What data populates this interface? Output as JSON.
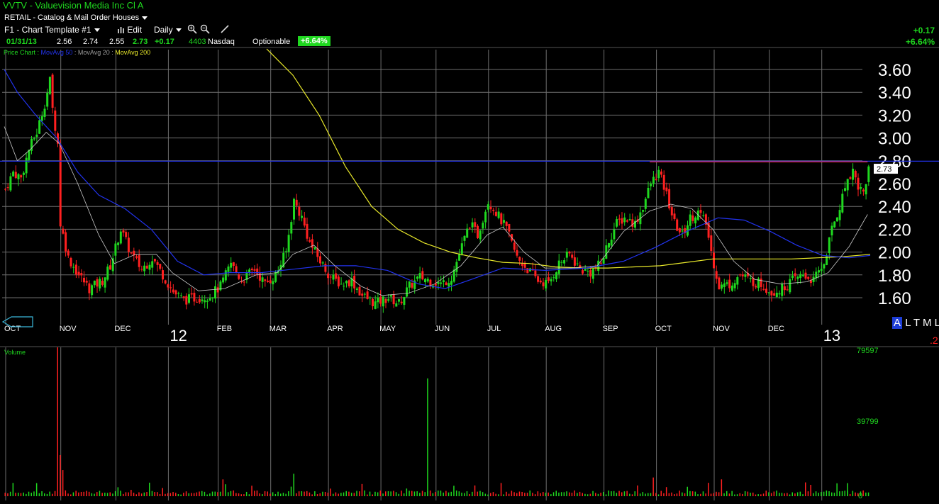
{
  "header": {
    "title": "VVTV - Valuevision Media Inc Cl A",
    "industry": "RETAIL - Catalog & Mail Order Houses",
    "template": "F1 - Chart Template #1",
    "edit_label": "Edit",
    "period": "Daily"
  },
  "quote": {
    "date": "01/31/13",
    "open": "2.56",
    "high": "2.74",
    "low": "2.55",
    "last": "2.73",
    "change": "+0.17",
    "volume": "4403",
    "exchange": "Nasdaq",
    "optionable": "Optionable",
    "pct_badge": "+6.64%",
    "right_change": "+0.17",
    "right_pct": "+6.64%"
  },
  "legend": {
    "price": "Price Chart",
    "ma50": "MovAvg 50",
    "ma20": "MovAvg 20",
    "ma200": "MovAvg 200",
    "volume_label": "Volume"
  },
  "tabs": {
    "a": "A",
    "l1": "L",
    "t": "T",
    "m": "M",
    "l2": "L",
    "extra": ".2"
  },
  "colors": {
    "up": "#1fd81f",
    "down": "#ff2020",
    "ma50": "#2233ee",
    "ma20": "#c8c8c8",
    "ma200": "#e8e82a",
    "hline_blue": "#2233ee",
    "hline_red": "#ff3030",
    "grid": "#6e6e6e"
  },
  "chart_data": [
    {
      "type": "candlestick",
      "title": "VVTV - Valuevision Media Inc Cl A",
      "last_label": "2.73",
      "ylim": [
        1.45,
        3.78
      ],
      "y_ticks": [
        1.6,
        1.8,
        2.0,
        2.2,
        2.4,
        2.6,
        2.8,
        3.0,
        3.2,
        3.4,
        3.6
      ],
      "y_tick_labels": [
        "1.60",
        "1.80",
        "2.00",
        "2.20",
        "2.40",
        "2.60",
        "2.80",
        "3.00",
        "3.20",
        "3.40",
        "3.60"
      ],
      "x_labels": [
        "OCT",
        "NOV",
        "DEC",
        "12",
        "FEB",
        "MAR",
        "APR",
        "MAY",
        "JUN",
        "JUL",
        "AUG",
        "SEP",
        "OCT",
        "NOV",
        "DEC",
        "13"
      ],
      "x_label_positions": [
        0,
        21,
        42,
        62,
        81,
        101,
        123,
        143,
        164,
        184,
        206,
        228,
        248,
        270,
        291,
        311
      ],
      "resistance_line": 2.79,
      "anchors": [
        [
          0,
          2.55
        ],
        [
          3,
          2.7
        ],
        [
          6,
          2.65
        ],
        [
          9,
          2.9
        ],
        [
          12,
          3.05
        ],
        [
          15,
          3.3
        ],
        [
          17,
          3.5
        ],
        [
          18,
          3.25
        ],
        [
          20,
          2.95
        ],
        [
          21,
          2.25
        ],
        [
          24,
          1.95
        ],
        [
          28,
          1.8
        ],
        [
          32,
          1.68
        ],
        [
          37,
          1.75
        ],
        [
          40,
          1.88
        ],
        [
          44,
          2.2
        ],
        [
          48,
          1.98
        ],
        [
          52,
          1.85
        ],
        [
          56,
          1.95
        ],
        [
          60,
          1.8
        ],
        [
          64,
          1.65
        ],
        [
          68,
          1.58
        ],
        [
          73,
          1.6
        ],
        [
          78,
          1.62
        ],
        [
          82,
          1.7
        ],
        [
          86,
          1.9
        ],
        [
          90,
          1.75
        ],
        [
          95,
          1.85
        ],
        [
          99,
          1.72
        ],
        [
          103,
          1.8
        ],
        [
          107,
          2.0
        ],
        [
          110,
          2.45
        ],
        [
          113,
          2.3
        ],
        [
          116,
          2.08
        ],
        [
          120,
          1.92
        ],
        [
          124,
          1.78
        ],
        [
          128,
          1.72
        ],
        [
          132,
          1.75
        ],
        [
          136,
          1.62
        ],
        [
          141,
          1.55
        ],
        [
          146,
          1.6
        ],
        [
          150,
          1.55
        ],
        [
          154,
          1.7
        ],
        [
          158,
          1.78
        ],
        [
          162,
          1.75
        ],
        [
          166,
          1.72
        ],
        [
          170,
          1.78
        ],
        [
          174,
          2.05
        ],
        [
          177,
          2.25
        ],
        [
          180,
          2.15
        ],
        [
          184,
          2.45
        ],
        [
          187,
          2.35
        ],
        [
          191,
          2.2
        ],
        [
          195,
          1.95
        ],
        [
          199,
          1.85
        ],
        [
          203,
          1.75
        ],
        [
          207,
          1.72
        ],
        [
          211,
          1.9
        ],
        [
          215,
          1.98
        ],
        [
          219,
          1.85
        ],
        [
          223,
          1.82
        ],
        [
          227,
          1.9
        ],
        [
          230,
          2.1
        ],
        [
          233,
          2.25
        ],
        [
          236,
          2.3
        ],
        [
          240,
          2.25
        ],
        [
          243,
          2.4
        ],
        [
          246,
          2.6
        ],
        [
          249,
          2.7
        ],
        [
          252,
          2.5
        ],
        [
          255,
          2.25
        ],
        [
          258,
          2.15
        ],
        [
          261,
          2.3
        ],
        [
          264,
          2.35
        ],
        [
          267,
          2.25
        ],
        [
          269,
          2.0
        ],
        [
          272,
          1.7
        ],
        [
          276,
          1.72
        ],
        [
          280,
          1.8
        ],
        [
          284,
          1.75
        ],
        [
          288,
          1.72
        ],
        [
          292,
          1.65
        ],
        [
          296,
          1.68
        ],
        [
          300,
          1.75
        ],
        [
          304,
          1.8
        ],
        [
          308,
          1.75
        ],
        [
          312,
          1.9
        ],
        [
          315,
          2.2
        ],
        [
          318,
          2.4
        ],
        [
          321,
          2.65
        ],
        [
          323,
          2.72
        ],
        [
          325,
          2.58
        ],
        [
          327,
          2.52
        ],
        [
          329,
          2.73
        ]
      ],
      "ma50_points": [
        [
          0,
          3.6
        ],
        [
          5,
          3.4
        ],
        [
          12,
          3.2
        ],
        [
          20,
          3.0
        ],
        [
          28,
          2.7
        ],
        [
          36,
          2.5
        ],
        [
          46,
          2.38
        ],
        [
          56,
          2.2
        ],
        [
          66,
          1.92
        ],
        [
          76,
          1.8
        ],
        [
          86,
          1.82
        ],
        [
          98,
          1.82
        ],
        [
          110,
          1.85
        ],
        [
          122,
          1.88
        ],
        [
          134,
          1.88
        ],
        [
          146,
          1.84
        ],
        [
          158,
          1.72
        ],
        [
          168,
          1.68
        ],
        [
          178,
          1.76
        ],
        [
          190,
          1.86
        ],
        [
          206,
          1.84
        ],
        [
          222,
          1.86
        ],
        [
          236,
          1.92
        ],
        [
          248,
          2.04
        ],
        [
          260,
          2.18
        ],
        [
          272,
          2.3
        ],
        [
          282,
          2.28
        ],
        [
          292,
          2.18
        ],
        [
          302,
          2.06
        ],
        [
          312,
          1.97
        ],
        [
          322,
          1.95
        ],
        [
          330,
          1.97
        ]
      ],
      "ma20_points": [
        [
          0,
          3.1
        ],
        [
          5,
          2.8
        ],
        [
          10,
          2.9
        ],
        [
          16,
          3.05
        ],
        [
          21,
          2.95
        ],
        [
          28,
          2.6
        ],
        [
          36,
          2.15
        ],
        [
          42,
          1.9
        ],
        [
          50,
          1.98
        ],
        [
          58,
          1.98
        ],
        [
          64,
          1.82
        ],
        [
          74,
          1.66
        ],
        [
          84,
          1.68
        ],
        [
          96,
          1.8
        ],
        [
          104,
          1.82
        ],
        [
          110,
          1.98
        ],
        [
          118,
          2.06
        ],
        [
          126,
          1.88
        ],
        [
          136,
          1.7
        ],
        [
          144,
          1.62
        ],
        [
          154,
          1.64
        ],
        [
          164,
          1.72
        ],
        [
          174,
          1.88
        ],
        [
          184,
          2.15
        ],
        [
          190,
          2.22
        ],
        [
          198,
          2.0
        ],
        [
          206,
          1.86
        ],
        [
          216,
          1.86
        ],
        [
          226,
          1.88
        ],
        [
          236,
          2.18
        ],
        [
          246,
          2.36
        ],
        [
          254,
          2.42
        ],
        [
          262,
          2.38
        ],
        [
          270,
          2.2
        ],
        [
          278,
          1.92
        ],
        [
          286,
          1.76
        ],
        [
          296,
          1.72
        ],
        [
          306,
          1.74
        ],
        [
          314,
          1.82
        ],
        [
          322,
          2.05
        ],
        [
          329,
          2.33
        ]
      ],
      "ma200_points": [
        [
          100,
          3.78
        ],
        [
          110,
          3.55
        ],
        [
          120,
          3.2
        ],
        [
          130,
          2.75
        ],
        [
          140,
          2.4
        ],
        [
          150,
          2.2
        ],
        [
          160,
          2.08
        ],
        [
          170,
          2.0
        ],
        [
          180,
          1.95
        ],
        [
          190,
          1.91
        ],
        [
          200,
          1.9
        ],
        [
          210,
          1.87
        ],
        [
          220,
          1.86
        ],
        [
          230,
          1.86
        ],
        [
          240,
          1.87
        ],
        [
          250,
          1.88
        ],
        [
          260,
          1.91
        ],
        [
          270,
          1.94
        ],
        [
          280,
          1.94
        ],
        [
          290,
          1.94
        ],
        [
          300,
          1.94
        ],
        [
          310,
          1.95
        ],
        [
          320,
          1.96
        ],
        [
          330,
          1.98
        ]
      ]
    },
    {
      "type": "bar",
      "title": "Volume",
      "ylim": [
        0,
        79597
      ],
      "y_tick_labels": [
        "79597",
        "39799",
        "0"
      ],
      "y_ticks": [
        79597,
        39799,
        0
      ],
      "spikes": [
        [
          20,
          79597,
          "down"
        ],
        [
          21,
          22000,
          "down"
        ],
        [
          22,
          14000,
          "down"
        ],
        [
          161,
          63000,
          "up"
        ],
        [
          110,
          12000,
          "up"
        ],
        [
          83,
          9000,
          "down"
        ],
        [
          247,
          10000,
          "down"
        ],
        [
          273,
          9000,
          "down"
        ],
        [
          321,
          7000,
          "up"
        ]
      ]
    }
  ]
}
